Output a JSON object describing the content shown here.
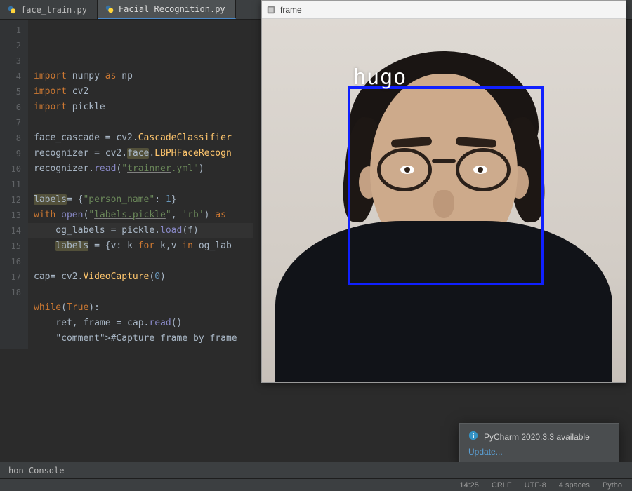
{
  "tabs": [
    {
      "label": "face_train.py",
      "active": false
    },
    {
      "label": "Facial Recognition.py",
      "active": true
    }
  ],
  "gutter_start": 1,
  "gutter_end": 18,
  "caret_line": 14,
  "code_lines": [
    "import numpy as np",
    "import cv2",
    "import pickle",
    "",
    "face_cascade = cv2.CascadeClassifier",
    "recognizer = cv2.face.LBPHFaceRecogn",
    "recognizer.read(\"trainner.yml\")",
    "",
    "labels= {\"person_name\": 1}",
    "with open(\"labels.pickle\", 'rb') as ",
    "    og_labels = pickle.load(f)",
    "    labels = {v: k for k,v in og_lab",
    "",
    "cap= cv2.VideoCapture(0)",
    "",
    "while(True):",
    "    ret, frame = cap.read()",
    "    #Capture frame by frame"
  ],
  "cv_window": {
    "title": "frame",
    "detection_label": "hugo"
  },
  "notification": {
    "title": "PyCharm 2020.3.3 available",
    "link": "Update..."
  },
  "toolwindow": {
    "label": "hon Console"
  },
  "statusbar": {
    "caret": "14:25",
    "eol": "CRLF",
    "encoding": "UTF-8",
    "indent": "4 spaces",
    "interpreter": "Pytho"
  }
}
